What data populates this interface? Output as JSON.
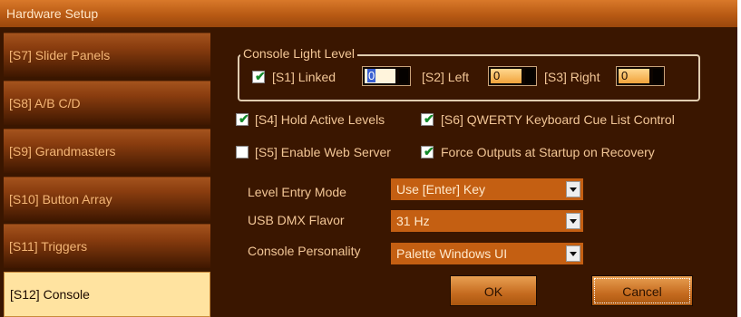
{
  "window": {
    "title": "Hardware Setup"
  },
  "sidebar": {
    "tabs": [
      {
        "label": "[S7] Slider Panels"
      },
      {
        "label": "[S8] A/B C/D"
      },
      {
        "label": "[S9] Grandmasters"
      },
      {
        "label": "[S10] Button Array"
      },
      {
        "label": "[S11] Triggers"
      },
      {
        "label": "[S12] Console"
      }
    ],
    "active_tab": "[S12] Console"
  },
  "light_level": {
    "legend": "Console Light Level",
    "linked": {
      "label": "[S1] Linked",
      "checked": true
    },
    "left": {
      "label": "[S2] Left",
      "value": "0"
    },
    "right": {
      "label": "[S3] Right",
      "value": "0"
    },
    "linked_value": "0"
  },
  "options": {
    "hold_active_levels": {
      "label": "[S4] Hold Active Levels",
      "checked": true
    },
    "qwerty": {
      "label": "[S6] QWERTY Keyboard Cue List Control",
      "checked": true
    },
    "web_server": {
      "label": "[S5] Enable Web Server",
      "checked": false
    },
    "force_outputs": {
      "label": "Force Outputs at Startup on Recovery",
      "checked": true
    }
  },
  "settings": {
    "level_entry": {
      "label": "Level Entry Mode",
      "value": "Use [Enter] Key"
    },
    "usb_dmx": {
      "label": "USB DMX Flavor",
      "value": "31 Hz"
    },
    "personality": {
      "label": "Console Personality",
      "value": "Palette Windows UI"
    }
  },
  "buttons": {
    "ok": "OK",
    "cancel": "Cancel"
  },
  "colors": {
    "titlebar": "#c86a1c",
    "background": "#3a1600",
    "active_tab": "#ffe3a0",
    "select": "#c45f12",
    "checkmark": "#138a2a"
  }
}
